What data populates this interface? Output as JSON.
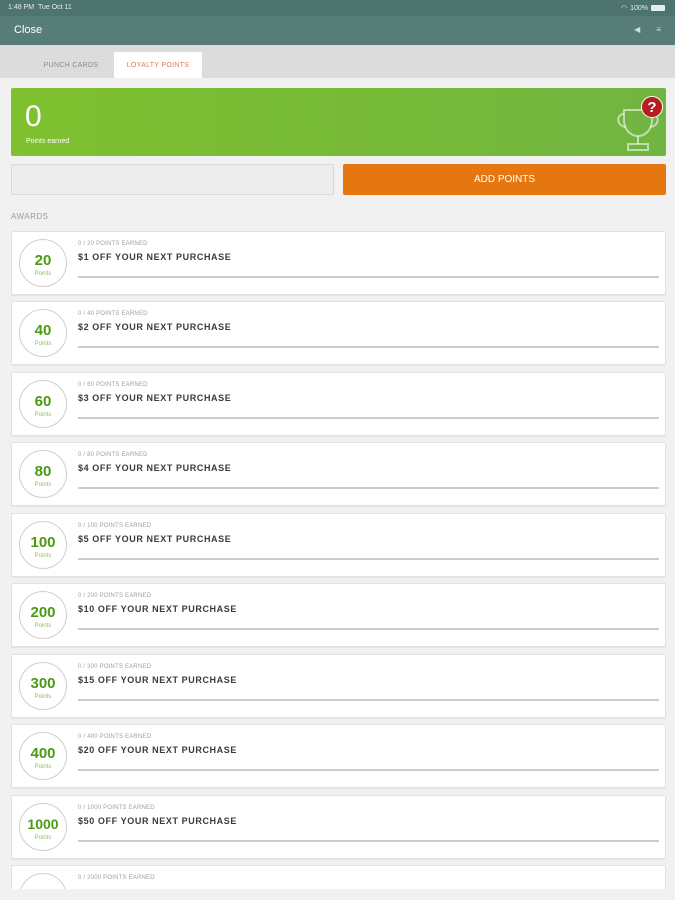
{
  "status_bar": {
    "time": "1:48 PM",
    "date": "Tue Oct 11",
    "battery": "100%"
  },
  "nav": {
    "close_label": "Close"
  },
  "tabs": [
    {
      "label": "PUNCH CARDS",
      "active": false
    },
    {
      "label": "LOYALTY POINTS",
      "active": true
    }
  ],
  "banner": {
    "points": "0",
    "caption": "Points earned",
    "help_symbol": "?"
  },
  "buttons": {
    "secondary_label": "",
    "add_points_label": "ADD POINTS"
  },
  "awards_heading": "AWARDS",
  "awards": [
    {
      "points": "20",
      "unit": "Points",
      "earned": "0 / 20 POINTS EARNED",
      "title": "$1 OFF YOUR NEXT PURCHASE",
      "progress": 0
    },
    {
      "points": "40",
      "unit": "Points",
      "earned": "0 / 40 POINTS EARNED",
      "title": "$2 OFF YOUR NEXT PURCHASE",
      "progress": 0
    },
    {
      "points": "60",
      "unit": "Points",
      "earned": "0 / 60 POINTS EARNED",
      "title": "$3 OFF YOUR NEXT PURCHASE",
      "progress": 0
    },
    {
      "points": "80",
      "unit": "Points",
      "earned": "0 / 80 POINTS EARNED",
      "title": "$4 OFF YOUR NEXT PURCHASE",
      "progress": 0
    },
    {
      "points": "100",
      "unit": "Points",
      "earned": "0 / 100 POINTS EARNED",
      "title": "$5 OFF YOUR NEXT PURCHASE",
      "progress": 0
    },
    {
      "points": "200",
      "unit": "Points",
      "earned": "0 / 200 POINTS EARNED",
      "title": "$10 OFF YOUR NEXT PURCHASE",
      "progress": 0
    },
    {
      "points": "300",
      "unit": "Points",
      "earned": "0 / 300 POINTS EARNED",
      "title": "$15 OFF YOUR NEXT PURCHASE",
      "progress": 0
    },
    {
      "points": "400",
      "unit": "Points",
      "earned": "0 / 400 POINTS EARNED",
      "title": "$20 OFF YOUR NEXT PURCHASE",
      "progress": 0
    },
    {
      "points": "1000",
      "unit": "Points",
      "earned": "0 / 1000 POINTS EARNED",
      "title": "$50 OFF YOUR NEXT PURCHASE",
      "progress": 0
    },
    {
      "points": "",
      "unit": "",
      "earned": "0 / 2000 POINTS EARNED",
      "title": "",
      "progress": 0
    }
  ],
  "colors": {
    "accent_green": "#7fc12f",
    "accent_orange": "#e57710",
    "nav_teal": "#577d78",
    "tab_active_text": "#e0785a"
  }
}
